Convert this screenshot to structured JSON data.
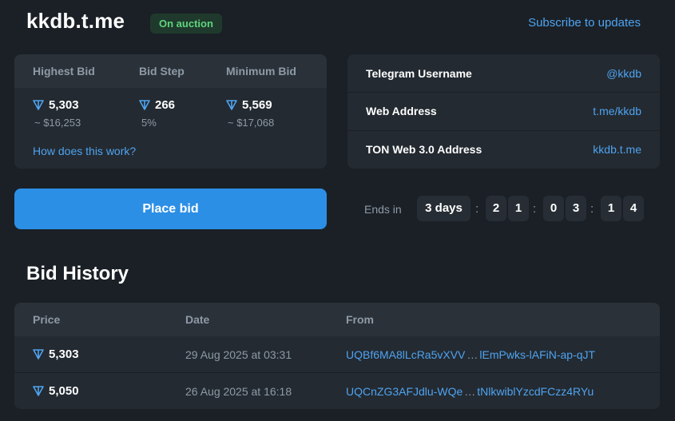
{
  "header": {
    "title": "kkdb.t.me",
    "status_badge": "On auction",
    "subscribe_link": "Subscribe to updates"
  },
  "bid_info": {
    "headers": [
      "Highest Bid",
      "Bid Step",
      "Minimum Bid"
    ],
    "highest_bid": {
      "value": "5,303",
      "usd": "~ $16,253"
    },
    "bid_step": {
      "value": "266",
      "percent": "5%"
    },
    "minimum_bid": {
      "value": "5,569",
      "usd": "~ $17,068"
    },
    "how_link": "How does this work?"
  },
  "username_info": {
    "rows": [
      {
        "label": "Telegram Username",
        "value": "@kkdb"
      },
      {
        "label": "Web Address",
        "value": "t.me/kkdb"
      },
      {
        "label": "TON Web 3.0 Address",
        "value": "kkdb.t.me"
      }
    ]
  },
  "place_bid_label": "Place bid",
  "timer": {
    "label": "Ends in",
    "days": "3 days",
    "digits": [
      "2",
      "1",
      "0",
      "3",
      "1",
      "4"
    ]
  },
  "bid_history": {
    "title": "Bid History",
    "columns": [
      "Price",
      "Date",
      "From"
    ],
    "rows": [
      {
        "price": "5,303",
        "date": "29 Aug 2025 at 03:31",
        "from_start": "UQBf6MA8lLcRa5vXVV",
        "from_end": "lEmPwks-lAFiN-ap-qJT"
      },
      {
        "price": "5,050",
        "date": "26 Aug 2025 at 16:18",
        "from_start": "UQCnZG3AFJdlu-WQe",
        "from_end": "tNlkwiblYzcdFCzz4RYu"
      }
    ]
  },
  "colors": {
    "background": "#1a2026",
    "card": "#232a31",
    "accent": "#2c8fe6",
    "link": "#4fa3f0",
    "badge_text": "#5fd47f"
  },
  "icons": [
    "ton-diamond-icon"
  ]
}
